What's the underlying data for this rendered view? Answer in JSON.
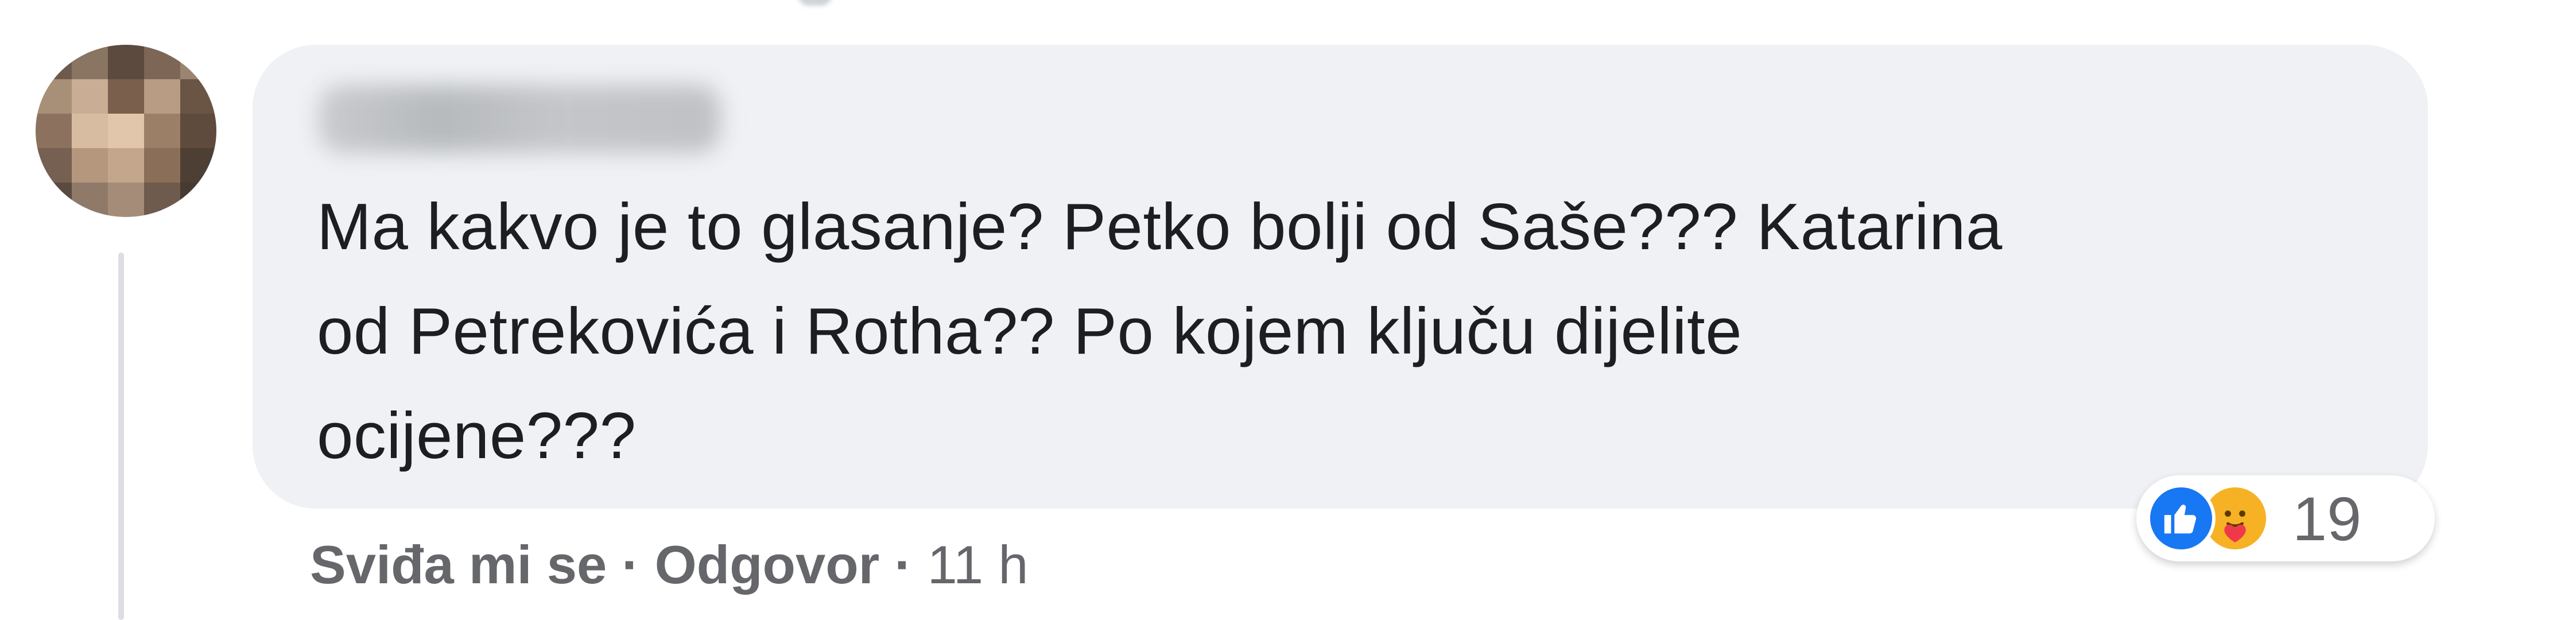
{
  "comment": {
    "author_name": "",
    "text": "Ma kakvo je to glasanje? Petko bolji od Saše??? Katarina\nod Petrekovića i Rotha?? Po kojem ključu dijelite\nocijene???",
    "reactions": {
      "types": [
        "like-icon",
        "care-icon"
      ],
      "count": "19"
    },
    "actions": {
      "like_label": "Sviđa mi se",
      "separator": "·",
      "reply_label": "Odgovor",
      "time": "11 h"
    }
  },
  "colors": {
    "bubble_bg": "#eff1f4",
    "text": "#1c1e21",
    "secondary_text": "#65676b",
    "like_blue": "#1877f2",
    "care_yellow": "#f7b125"
  }
}
